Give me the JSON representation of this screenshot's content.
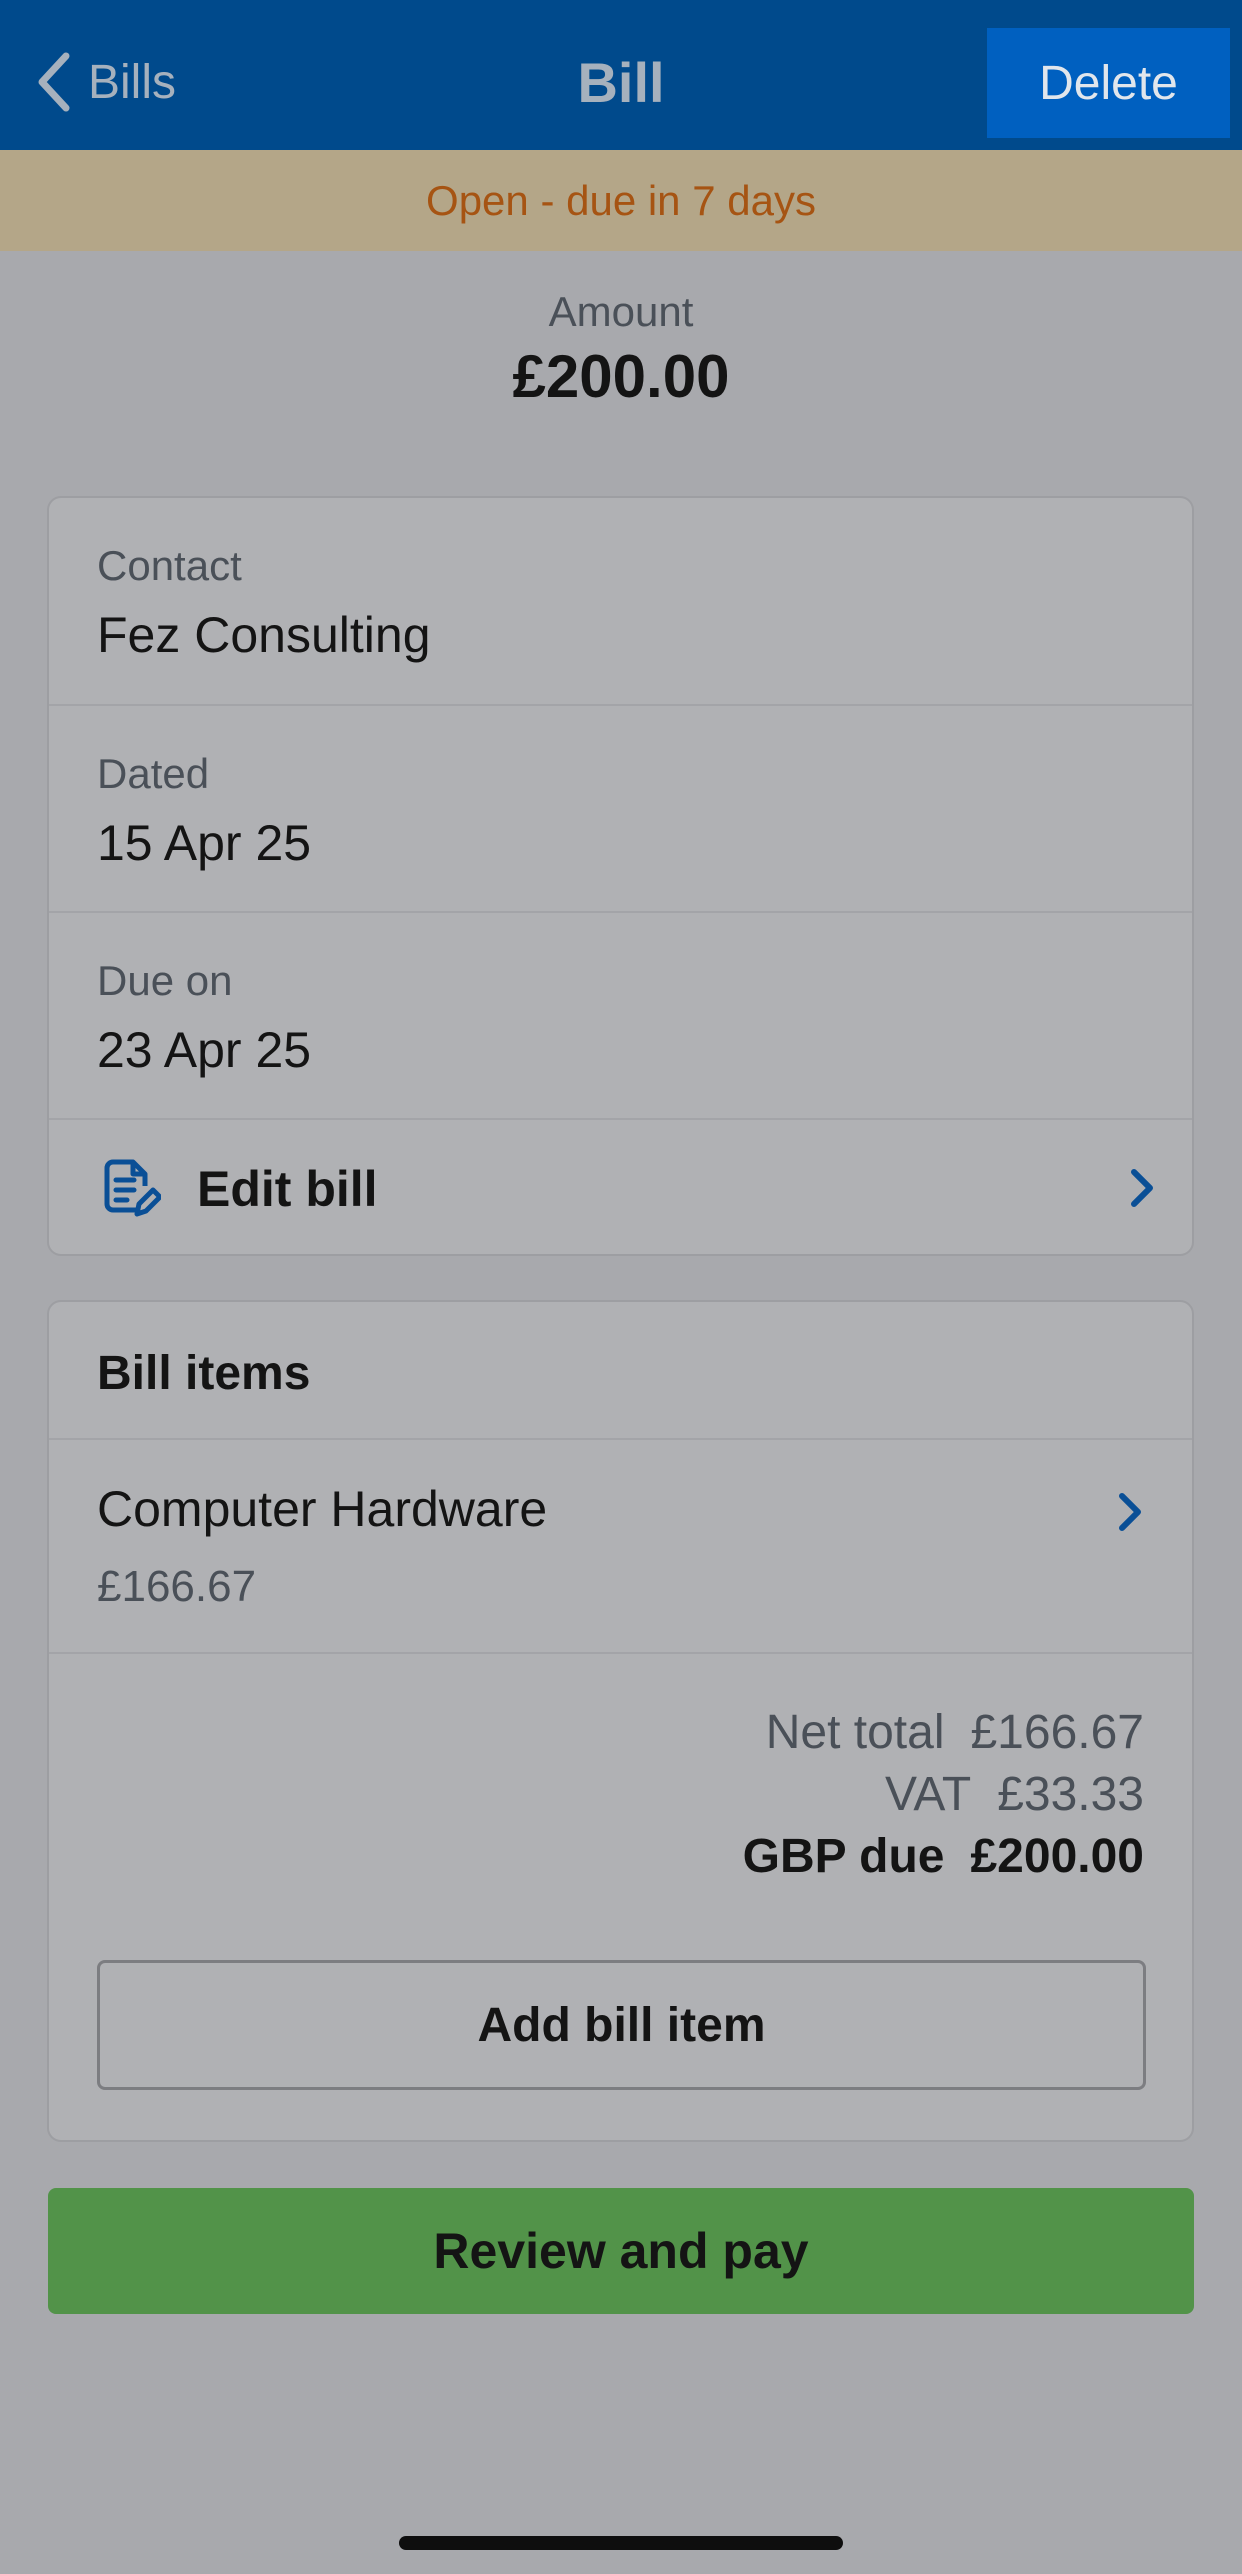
{
  "nav": {
    "back_label": "Bills",
    "title": "Bill",
    "delete_label": "Delete"
  },
  "status": "Open - due in 7 days",
  "amount": {
    "label": "Amount",
    "value": "£200.00"
  },
  "details": {
    "contact_label": "Contact",
    "contact_value": "Fez Consulting",
    "dated_label": "Dated",
    "dated_value": "15 Apr 25",
    "due_label": "Due on",
    "due_value": "23 Apr 25",
    "edit_label": "Edit bill"
  },
  "items": {
    "header": "Bill items",
    "list": [
      {
        "name": "Computer Hardware",
        "price": "£166.67"
      }
    ],
    "net_total_label": "Net total",
    "net_total_value": "£166.67",
    "vat_label": "VAT",
    "vat_value": "£33.33",
    "due_label": "GBP due",
    "due_value": "£200.00",
    "add_label": "Add bill item"
  },
  "pay_label": "Review and pay",
  "icons": {
    "back": "chevron-left-icon",
    "edit": "edit-document-icon",
    "chevron": "chevron-right-icon"
  },
  "colors": {
    "nav_bg": "#004a8c",
    "delete_bg": "#0060c0",
    "status_bg": "#b4a688",
    "status_text": "#a65413",
    "pay_bg": "#529349",
    "accent": "#004a8c"
  }
}
